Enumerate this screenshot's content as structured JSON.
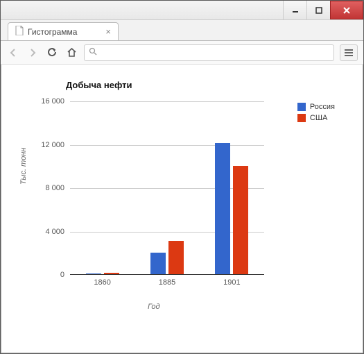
{
  "window": {
    "tab_title": "Гистограмма"
  },
  "toolbar": {
    "url_value": ""
  },
  "chart_data": {
    "type": "bar",
    "title": "Добыча нефти",
    "xlabel": "Год",
    "ylabel": "Тыс. тонн",
    "categories": [
      "1860",
      "1885",
      "1901"
    ],
    "series": [
      {
        "name": "Россия",
        "color": "#3366cc",
        "values": [
          50,
          2000,
          12100
        ]
      },
      {
        "name": "США",
        "color": "#dc3912",
        "values": [
          100,
          3100,
          10000
        ]
      }
    ],
    "ylim": [
      0,
      16000
    ],
    "yticks": [
      0,
      4000,
      8000,
      12000,
      16000
    ],
    "ytick_labels": [
      "0",
      "4 000",
      "8 000",
      "12 000",
      "16 000"
    ]
  }
}
